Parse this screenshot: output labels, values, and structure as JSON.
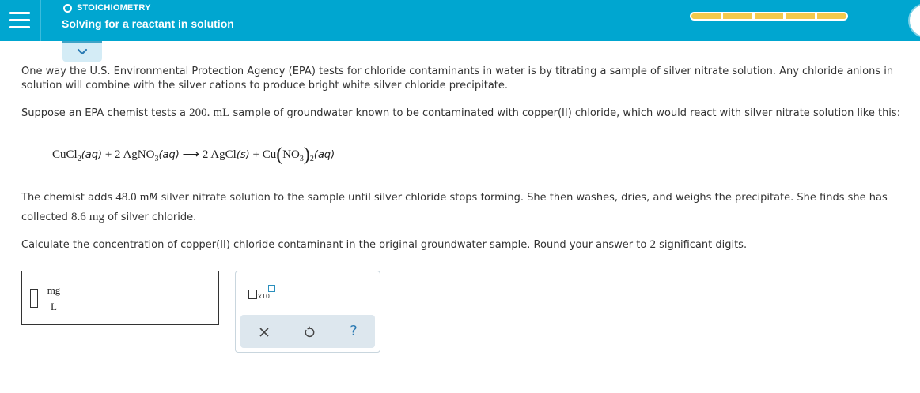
{
  "header": {
    "topic": "STOICHIOMETRY",
    "title": "Solving for a reactant in solution",
    "progress_segments": 5,
    "colors": {
      "bar": "#00a6d0",
      "progress": "#f2c94c"
    }
  },
  "icons": {
    "menu": "hamburger-menu-icon",
    "collapse": "chevron-down-icon",
    "topic_status": "circle-outline-icon",
    "clear": "x-icon",
    "undo": "undo-icon",
    "help": "question-icon"
  },
  "problem": {
    "p1": "One way the U.S. Environmental Protection Agency (EPA) tests for chloride contaminants in water is by titrating a sample of silver nitrate solution. Any chloride anions in solution will combine with the silver cations to produce bright white silver chloride precipitate.",
    "p2_pre": "Suppose an EPA chemist tests a ",
    "p2_value": "200.",
    "p2_unit": "mL",
    "p2_post": " sample of groundwater known to be contaminated with copper(II) chloride, which would react with silver nitrate solution like this:",
    "equation": {
      "r1_formula": "CuCl",
      "r1_sub": "2",
      "r1_state": "(aq)",
      "plus1": " + ",
      "coef2": "2 ",
      "r2_formula": "AgNO",
      "r2_sub": "3",
      "r2_state": "(aq)",
      "arrow": " ⟶ ",
      "coef3": "2 ",
      "p1_formula": "AgCl",
      "p1_state": "(s)",
      "plus2": " + ",
      "p2_formula": "Cu",
      "p2_inner": "NO",
      "p2_inner_sub": "3",
      "p2_outer_sub": "2",
      "p2_state": "(aq)"
    },
    "p3_pre": "The chemist adds ",
    "p3_value1": "48.0",
    "p3_unit1": "m",
    "p3_unit1_it": "M",
    "p3_mid": " silver nitrate solution to the sample until silver chloride stops forming. She then washes, dries, and weighs the precipitate. She finds she has collected ",
    "p3_value2": "8.6",
    "p3_unit2": "mg",
    "p3_post": " of silver chloride.",
    "p4_pre": "Calculate the concentration of copper(II) chloride contaminant in the original groundwater sample. Round your answer to ",
    "p4_value": "2",
    "p4_post": " significant digits."
  },
  "answer": {
    "value": "",
    "unit_num": "mg",
    "unit_den": "L"
  },
  "toolbox": {
    "x10_label": "x10",
    "help_label": "?"
  }
}
